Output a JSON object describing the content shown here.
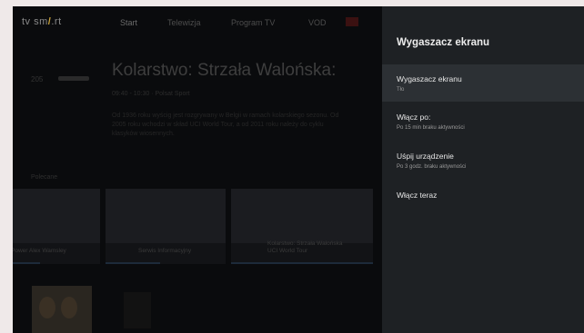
{
  "background": {
    "logo_left": "tv sm",
    "logo_slash": "/",
    "logo_right": ".rt",
    "nav": [
      "Start",
      "Telewizja",
      "Program TV",
      "VOD"
    ],
    "channel_number": "205",
    "hero_title": "Kolarstwo: Strzała Walońska:",
    "hero_meta": "09:40 - 10:30  ·  Polsat Sport",
    "hero_description": "Od 1936 roku wyścig jest rozgrywany w Belgii w ramach kolarskiego sezonu. Od 2005 roku wchodzi w skład UCI World Tour, a od 2011 roku należy do cyklu klasyków wiosennych.",
    "section_label": "Polecane",
    "tiles": [
      {
        "caption": "Power Alex Wamsley"
      },
      {
        "caption": "Serwis Informacyjny"
      },
      {
        "caption": "Kolarstwo: Strzała Walońska\nUCI World Tour"
      }
    ]
  },
  "panel": {
    "title": "Wygaszacz ekranu",
    "items": [
      {
        "label": "Wygaszacz ekranu",
        "sub": "Tło",
        "selected": true
      },
      {
        "label": "Włącz po:",
        "sub": "Po 15 min braku aktywności",
        "selected": false
      },
      {
        "label": "Uśpij urządzenie",
        "sub": "Po 3 godz. braku aktywności",
        "selected": false
      },
      {
        "label": "Włącz teraz",
        "sub": "",
        "selected": false
      }
    ]
  }
}
